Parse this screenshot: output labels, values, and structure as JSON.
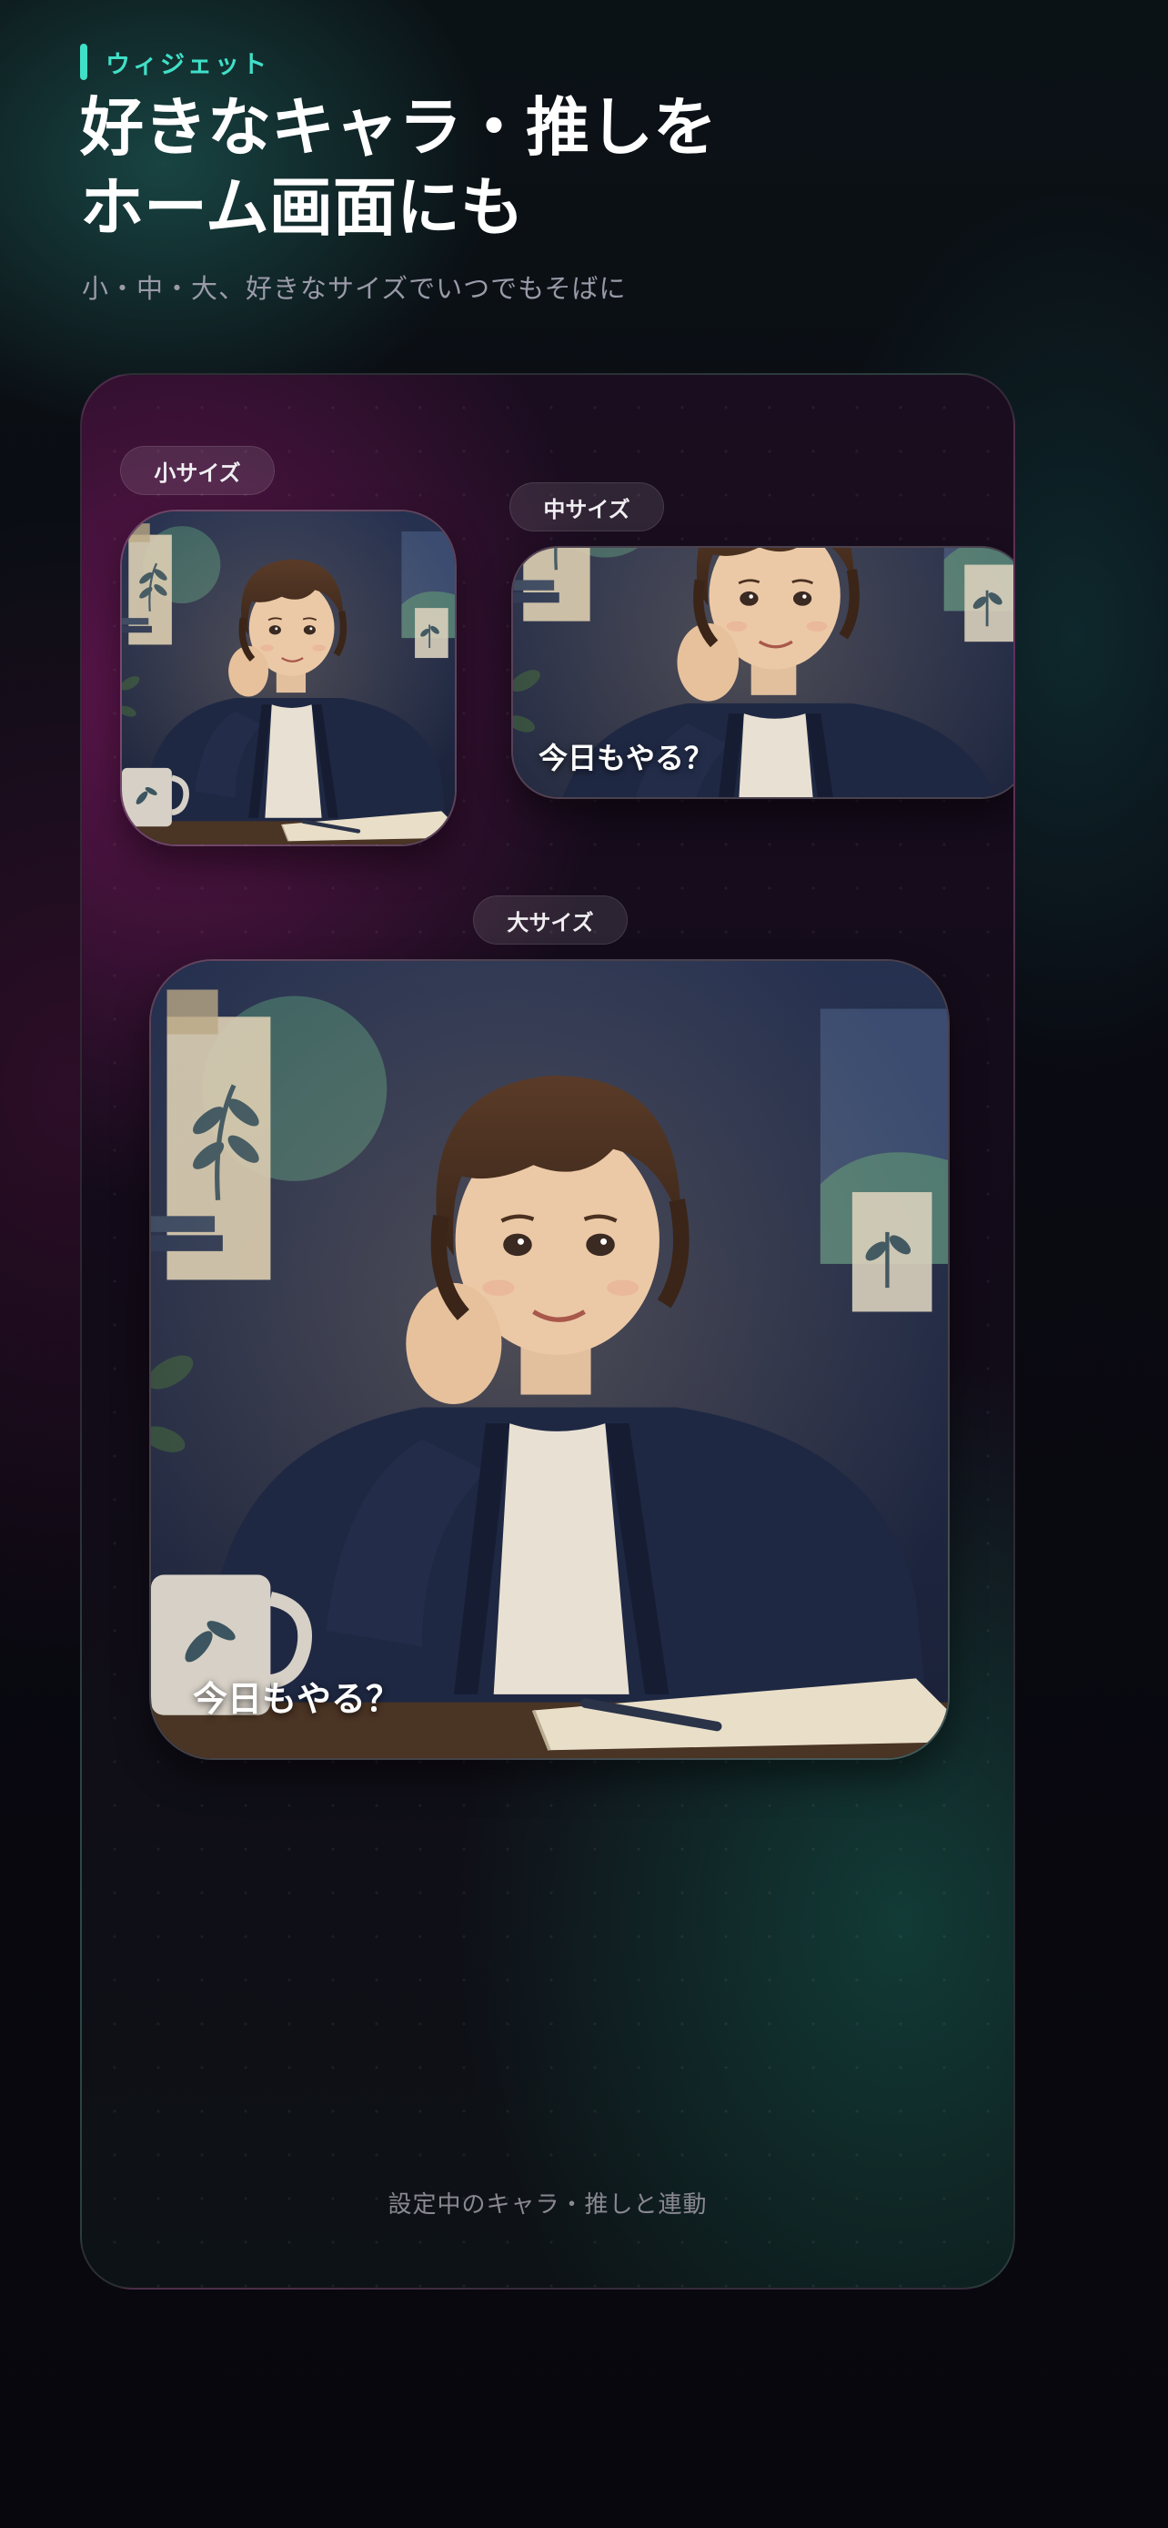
{
  "header": {
    "eyebrow": "ウィジェット",
    "title_line1": "好きなキャラ・推しを",
    "title_line2": "ホーム画面にも",
    "subtitle": "小・中・大、好きなサイズでいつでもそばに"
  },
  "preview": {
    "small": {
      "label": "小サイズ"
    },
    "medium": {
      "label": "中サイズ",
      "caption": "今日もやる？"
    },
    "large": {
      "label": "大サイズ",
      "caption": "今日もやる？"
    },
    "footer_note": "設定中のキャラ・推しと連動"
  },
  "colors": {
    "accent": "#3fe0c7",
    "background": "#07070c",
    "panel_magenta": "#781a5f",
    "panel_teal": "#145f50",
    "cardigan_navy": "#1c2440",
    "wall_navy": "#202a45"
  },
  "icons": {
    "eyebrow_marker": "accent-bar"
  }
}
